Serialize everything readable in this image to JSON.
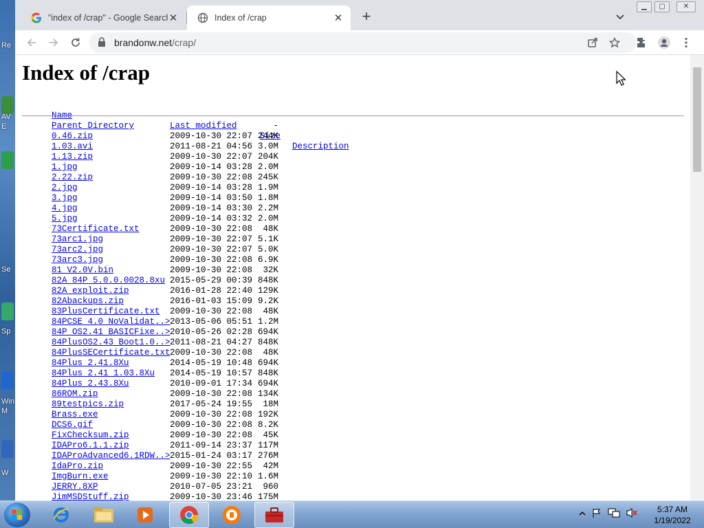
{
  "desktop": {
    "labels": [
      "Re",
      "AV",
      "E",
      "Se",
      "Sp",
      "Win",
      "M",
      "W"
    ]
  },
  "browser": {
    "tabs": [
      {
        "title": "\"index of /crap\" - Google Search",
        "active": false,
        "favicon": "google-icon"
      },
      {
        "title": "Index of /crap",
        "active": true,
        "favicon": "globe-icon"
      }
    ],
    "url_host": "brandonw.net",
    "url_path": "/crap/"
  },
  "page": {
    "heading": "Index of /crap",
    "columns": {
      "name": "Name",
      "last_modified": "Last modified",
      "size": "Size",
      "description": "Description"
    },
    "rows": [
      {
        "name": "Parent Directory",
        "date": "",
        "size": "-"
      },
      {
        "name": "0.46.zip",
        "date": "2009-10-30 22:07",
        "size": "244K"
      },
      {
        "name": "1.03.avi",
        "date": "2011-08-21 04:56",
        "size": "3.0M"
      },
      {
        "name": "1.13.zip",
        "date": "2009-10-30 22:07",
        "size": "204K"
      },
      {
        "name": "1.jpg",
        "date": "2009-10-14 03:28",
        "size": "2.0M"
      },
      {
        "name": "2.22.zip",
        "date": "2009-10-30 22:08",
        "size": "245K"
      },
      {
        "name": "2.jpg",
        "date": "2009-10-14 03:28",
        "size": "1.9M"
      },
      {
        "name": "3.jpg",
        "date": "2009-10-14 03:50",
        "size": "1.8M"
      },
      {
        "name": "4.jpg",
        "date": "2009-10-14 03:30",
        "size": "2.2M"
      },
      {
        "name": "5.jpg",
        "date": "2009-10-14 03:32",
        "size": "2.0M"
      },
      {
        "name": "73Certificate.txt",
        "date": "2009-10-30 22:08",
        "size": "48K"
      },
      {
        "name": "73arc1.jpg",
        "date": "2009-10-30 22:07",
        "size": "5.1K"
      },
      {
        "name": "73arc2.jpg",
        "date": "2009-10-30 22:07",
        "size": "5.0K"
      },
      {
        "name": "73arc3.jpg",
        "date": "2009-10-30 22:08",
        "size": "6.9K"
      },
      {
        "name": "81_V2.0V.bin",
        "date": "2009-10-30 22:08",
        "size": "32K"
      },
      {
        "name": "82A_84P_5.0.0.0028.8xu",
        "date": "2015-05-29 00:39",
        "size": "848K"
      },
      {
        "name": "82A_exploit.zip",
        "date": "2016-01-28 22:40",
        "size": "129K"
      },
      {
        "name": "82Abackups.zip",
        "date": "2016-01-03 15:09",
        "size": "9.2K"
      },
      {
        "name": "83PlusCertificate.txt",
        "date": "2009-10-30 22:08",
        "size": "48K"
      },
      {
        "name": "84PCSE_4.0_NoValidat..>",
        "date": "2013-05-06 05:51",
        "size": "1.2M"
      },
      {
        "name": "84P_OS2.41_BASICFixe..>",
        "date": "2010-05-26 02:28",
        "size": "694K"
      },
      {
        "name": "84PlusOS2.43_Boot1.0..>",
        "date": "2011-08-21 04:27",
        "size": "848K"
      },
      {
        "name": "84PlusSECertificate.txt",
        "date": "2009-10-30 22:08",
        "size": "48K"
      },
      {
        "name": "84Plus_2.41.8Xu",
        "date": "2014-05-19 10:48",
        "size": "694K"
      },
      {
        "name": "84Plus_2.41_1.03.8Xu",
        "date": "2014-05-19 10:57",
        "size": "848K"
      },
      {
        "name": "84Plus_2.43.8Xu",
        "date": "2010-09-01 17:34",
        "size": "694K"
      },
      {
        "name": "86ROM.zip",
        "date": "2009-10-30 22:08",
        "size": "134K"
      },
      {
        "name": "89testpics.zip",
        "date": "2017-05-24 19:55",
        "size": "18M"
      },
      {
        "name": "Brass.exe",
        "date": "2009-10-30 22:08",
        "size": "192K"
      },
      {
        "name": "DCS6.gif",
        "date": "2009-10-30 22:08",
        "size": "8.2K"
      },
      {
        "name": "FixChecksum.zip",
        "date": "2009-10-30 22:08",
        "size": "45K"
      },
      {
        "name": "IDAPro6.1.1.zip",
        "date": "2011-09-14 23:37",
        "size": "117M"
      },
      {
        "name": "IDAProAdvanced6.1RDW..>",
        "date": "2015-01-24 03:17",
        "size": "276M"
      },
      {
        "name": "IdaPro.zip",
        "date": "2009-10-30 22:55",
        "size": "42M"
      },
      {
        "name": "ImgBurn.exe",
        "date": "2009-10-30 22:10",
        "size": "1.6M"
      },
      {
        "name": "JERRY.8XP",
        "date": "2010-07-05 23:21",
        "size": "960"
      },
      {
        "name": "JimMSDStuff.zip",
        "date": "2009-10-30 23:46",
        "size": "175M"
      }
    ]
  },
  "taskbar": {
    "apps": [
      "ie-icon",
      "explorer-icon",
      "media-player-icon",
      "chrome-icon",
      "avast-icon",
      "toolbox-icon"
    ],
    "time": "5:37 AM",
    "date": "1/19/2022"
  }
}
